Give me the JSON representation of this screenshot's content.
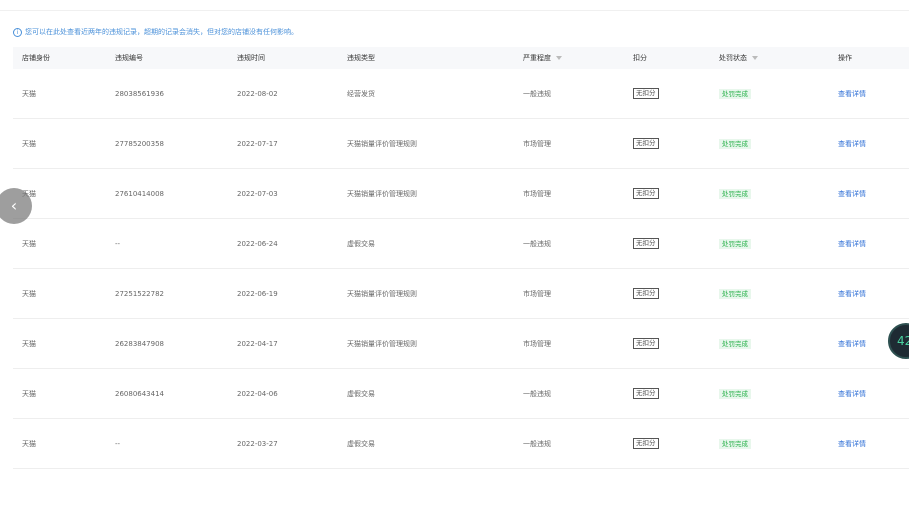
{
  "notice": {
    "text": "您可以在此处查看近两年的违规记录，超期的记录会消失，但对您的店铺没有任何影响。"
  },
  "table": {
    "headers": [
      "店铺身份",
      "违规编号",
      "违规时间",
      "违规类型",
      "严重程度",
      "扣分",
      "处罚状态",
      "操作"
    ],
    "rows": [
      {
        "shop": "天猫",
        "id": "28038561936",
        "time": "2022-08-02",
        "type": "经营发货",
        "severity": "一般违规",
        "deduct": "无扣分",
        "status": "处罚完成",
        "action": "查看详情"
      },
      {
        "shop": "天猫",
        "id": "27785200358",
        "time": "2022-07-17",
        "type": "天猫销量评价管理规则",
        "severity": "市场管理",
        "deduct": "无扣分",
        "status": "处罚完成",
        "action": "查看详情"
      },
      {
        "shop": "天猫",
        "id": "27610414008",
        "time": "2022-07-03",
        "type": "天猫销量评价管理规则",
        "severity": "市场管理",
        "deduct": "无扣分",
        "status": "处罚完成",
        "action": "查看详情"
      },
      {
        "shop": "天猫",
        "id": "--",
        "time": "2022-06-24",
        "type": "虚假交易",
        "severity": "一般违规",
        "deduct": "无扣分",
        "status": "处罚完成",
        "action": "查看详情"
      },
      {
        "shop": "天猫",
        "id": "27251522782",
        "time": "2022-06-19",
        "type": "天猫销量评价管理规则",
        "severity": "市场管理",
        "deduct": "无扣分",
        "status": "处罚完成",
        "action": "查看详情"
      },
      {
        "shop": "天猫",
        "id": "26283847908",
        "time": "2022-04-17",
        "type": "天猫销量评价管理规则",
        "severity": "市场管理",
        "deduct": "无扣分",
        "status": "处罚完成",
        "action": "查看详情"
      },
      {
        "shop": "天猫",
        "id": "26080643414",
        "time": "2022-04-06",
        "type": "虚假交易",
        "severity": "一般违规",
        "deduct": "无扣分",
        "status": "处罚完成",
        "action": "查看详情"
      },
      {
        "shop": "天猫",
        "id": "--",
        "time": "2022-03-27",
        "type": "虚假交易",
        "severity": "一般违规",
        "deduct": "无扣分",
        "status": "处罚完成",
        "action": "查看详情"
      }
    ]
  },
  "nav": {
    "prev_arrow": "‹"
  },
  "float_widget": {
    "text": "42"
  },
  "colors": {
    "link": "#2f6fd6",
    "status_green": "#2bb24c",
    "notice_blue": "#4a90d9"
  },
  "icons": {
    "notice": "info-icon",
    "filter": "filter-icon",
    "prev": "chevron-left-icon"
  }
}
